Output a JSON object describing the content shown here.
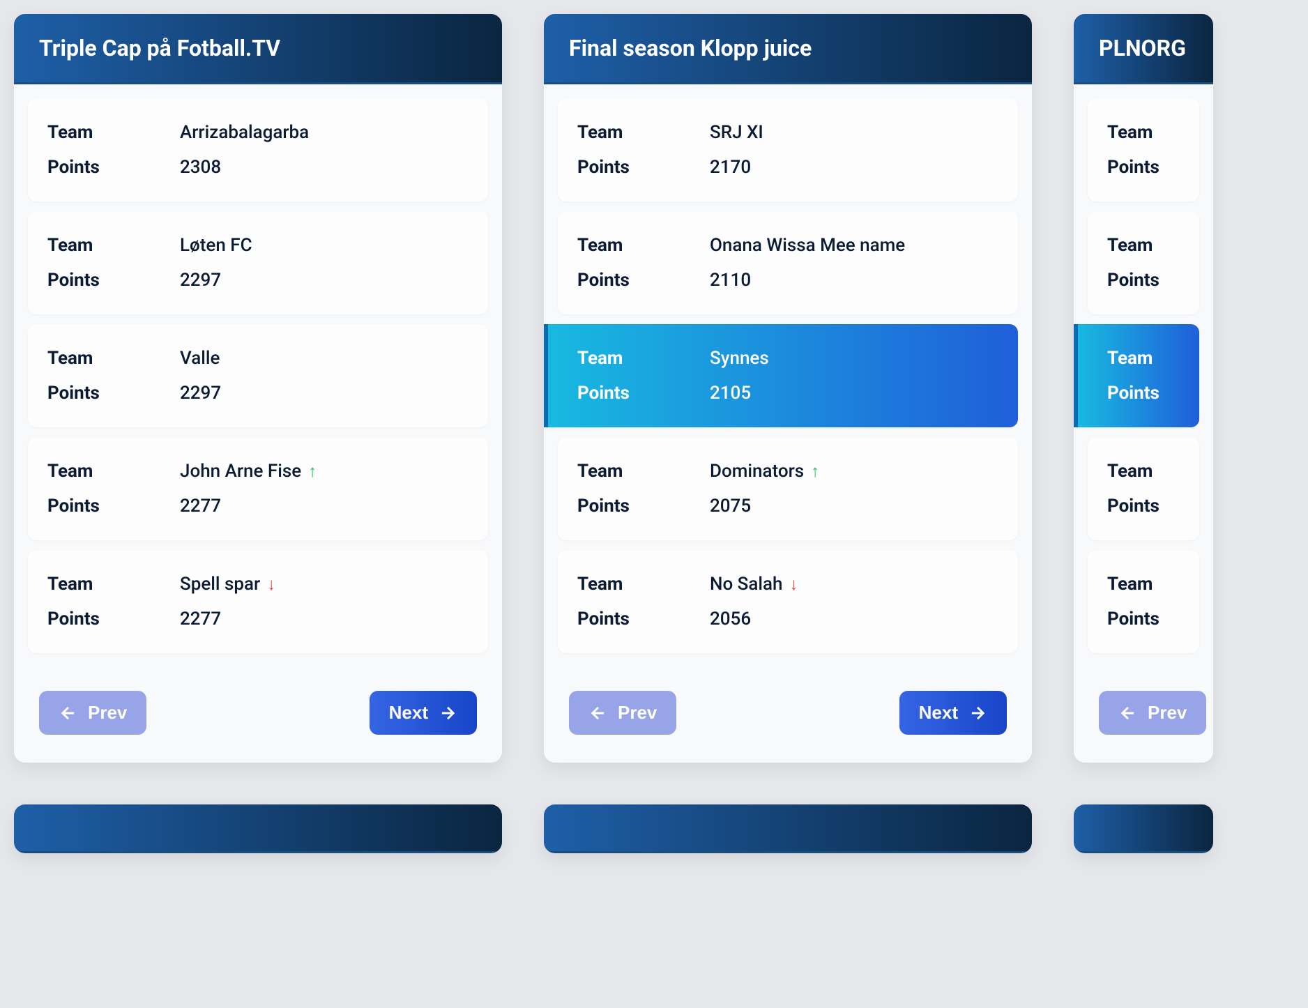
{
  "labels": {
    "team": "Team",
    "points": "Points",
    "prev": "Prev",
    "next": "Next"
  },
  "cards": [
    {
      "title": "Triple Cap på Fotball.TV",
      "rows": [
        {
          "team": "Arrizabalagarba",
          "points": "2308",
          "trend": null,
          "highlighted": false
        },
        {
          "team": "Løten FC",
          "points": "2297",
          "trend": null,
          "highlighted": false
        },
        {
          "team": "Valle",
          "points": "2297",
          "trend": null,
          "highlighted": false
        },
        {
          "team": "John Arne Fise",
          "points": "2277",
          "trend": "up",
          "highlighted": false
        },
        {
          "team": "Spell spar",
          "points": "2277",
          "trend": "down",
          "highlighted": false
        }
      ]
    },
    {
      "title": "Final season Klopp juice",
      "rows": [
        {
          "team": "SRJ XI",
          "points": "2170",
          "trend": null,
          "highlighted": false
        },
        {
          "team": "Onana Wissa Mee name",
          "points": "2110",
          "trend": null,
          "highlighted": false
        },
        {
          "team": "Synnes",
          "points": "2105",
          "trend": null,
          "highlighted": true
        },
        {
          "team": "Dominators",
          "points": "2075",
          "trend": "up",
          "highlighted": false
        },
        {
          "team": "No Salah",
          "points": "2056",
          "trend": "down",
          "highlighted": false
        }
      ]
    },
    {
      "title": "PLNORG",
      "rows": [
        {
          "team": "",
          "points": "",
          "trend": null,
          "highlighted": false
        },
        {
          "team": "",
          "points": "",
          "trend": null,
          "highlighted": false
        },
        {
          "team": "",
          "points": "",
          "trend": null,
          "highlighted": true
        },
        {
          "team": "",
          "points": "",
          "trend": null,
          "highlighted": false
        },
        {
          "team": "",
          "points": "",
          "trend": null,
          "highlighted": false
        }
      ]
    }
  ]
}
